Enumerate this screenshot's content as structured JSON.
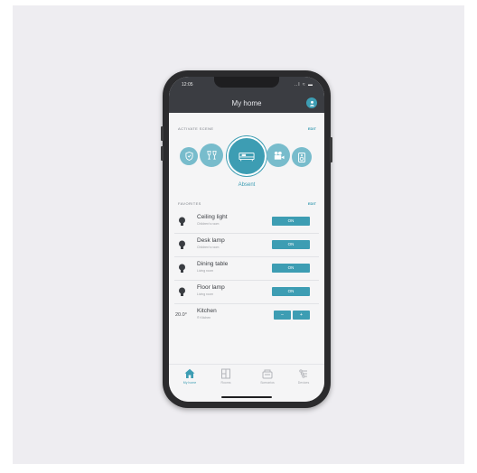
{
  "status_bar": {
    "time": "12:05",
    "indicators": "..l ≈ ▬"
  },
  "header": {
    "title": "My home",
    "profile_icon": "user-icon"
  },
  "scenes": {
    "section_label": "ACTIVATE SCENE",
    "edit_label": "EDIT",
    "items": [
      {
        "icon": "shield-icon",
        "active": false
      },
      {
        "icon": "cheers-icon",
        "active": false
      },
      {
        "icon": "bed-icon",
        "active": true
      },
      {
        "icon": "projector-icon",
        "active": false
      },
      {
        "icon": "speaker-icon",
        "active": false
      }
    ],
    "active_label": "Absent"
  },
  "favorites": {
    "section_label": "FAVORITES",
    "edit_label": "EDIT",
    "items": [
      {
        "name": "Ceiling light",
        "room": "Children's room",
        "type": "light",
        "button": "ON"
      },
      {
        "name": "Desk lamp",
        "room": "Children's room",
        "type": "light",
        "button": "ON"
      },
      {
        "name": "Dining table",
        "room": "Living room",
        "type": "light",
        "button": "ON"
      },
      {
        "name": "Floor lamp",
        "room": "Living room",
        "type": "light",
        "button": "ON"
      },
      {
        "name": "Kitchen",
        "room": "® Kitchen",
        "type": "thermostat",
        "temperature": "20.0°",
        "minus": "–",
        "plus": "+"
      }
    ]
  },
  "tabbar": {
    "items": [
      {
        "label": "My home",
        "icon": "home-icon",
        "active": true
      },
      {
        "label": "Rooms",
        "icon": "rooms-icon",
        "active": false
      },
      {
        "label": "Scenarios",
        "icon": "scenarios-icon",
        "active": false
      },
      {
        "label": "Devices",
        "icon": "devices-icon",
        "active": false
      }
    ]
  },
  "colors": {
    "accent": "#3d9db3",
    "accent_light": "#78bccc",
    "header": "#3b3d42",
    "frame": "#2b2b2d"
  }
}
